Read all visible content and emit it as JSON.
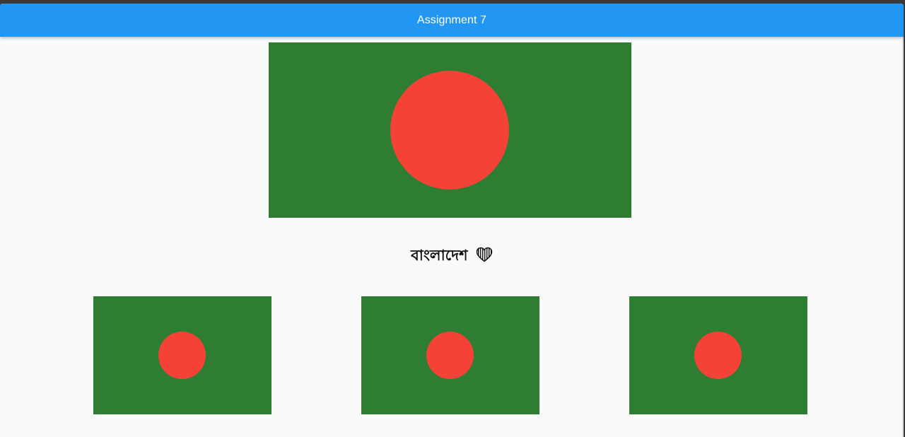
{
  "app": {
    "title": "Assignment 7"
  },
  "colors": {
    "appbar": "#2196f3",
    "flag_field": "#2e7d32",
    "flag_disc": "#f44336",
    "background": "#fafafa"
  },
  "main": {
    "caption": "বাংলাদেশ",
    "caption_icon": "striped-heart-icon"
  }
}
